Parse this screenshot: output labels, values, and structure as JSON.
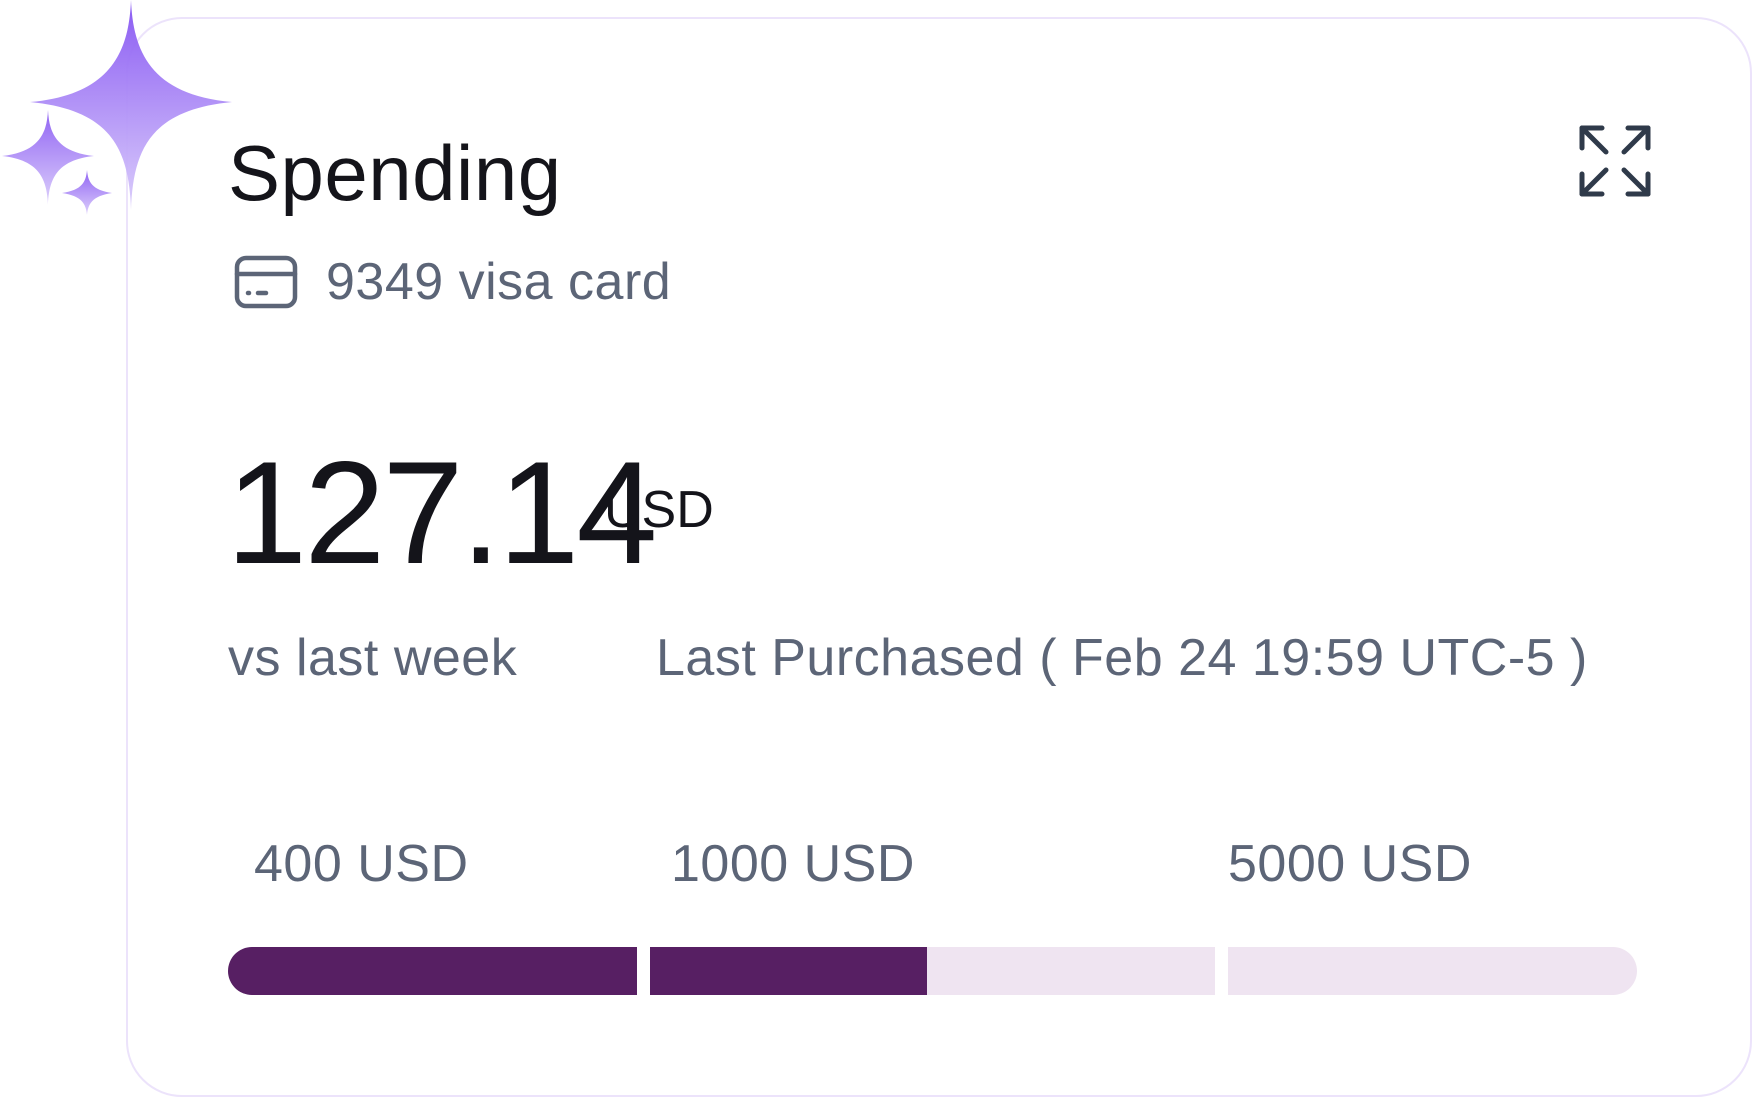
{
  "widget": {
    "title": "Spending",
    "expand_icon": "expand-icon",
    "card_icon": "credit-card-icon",
    "card_label": "9349 visa card",
    "amount": "127.14",
    "currency": "USD",
    "comparison_label": "vs last week",
    "last_purchased": "Last Purchased ( Feb 24 19:59 UTC-5 )",
    "sparkle_icon": "sparkles-icon"
  },
  "thresholds": [
    {
      "label": "400 USD",
      "fill_fraction": 1.0
    },
    {
      "label": "1000 USD",
      "fill_fraction": 0.49
    },
    {
      "label": "5000 USD",
      "fill_fraction": 0.0
    }
  ],
  "colors": {
    "bar_filled": "#571f63",
    "bar_track": "#efe4f1",
    "sparkle": "#8b63f5",
    "border": "#ece3fb",
    "muted_text": "#5c6577"
  }
}
